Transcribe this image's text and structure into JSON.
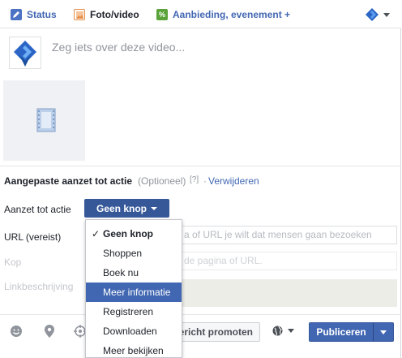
{
  "tabs": {
    "status": "Status",
    "photo_video": "Foto/video",
    "offer_event": "Aanbieding, evenement +"
  },
  "composer": {
    "placeholder": "Zeg iets over deze video..."
  },
  "cta": {
    "title": "Aangepaste aanzet tot actie",
    "optional": "(Optioneel)",
    "help": "[?]",
    "dot": "·",
    "remove": "Verwijderen",
    "label": "Aanzet tot actie",
    "button_label": "Geen knop"
  },
  "fields": {
    "url_label": "URL (vereist)",
    "url_placeholder": "a of URL je wilt dat mensen gaan bezoeken",
    "heading_label": "Kop",
    "heading_placeholder": "de pagina of URL.",
    "description_label": "Linkbeschrijving"
  },
  "menu": {
    "items": [
      {
        "label": "Geen knop",
        "checked": true
      },
      {
        "label": "Shoppen"
      },
      {
        "label": "Boek nu"
      },
      {
        "label": "Meer informatie",
        "highlighted": true
      },
      {
        "label": "Registreren"
      },
      {
        "label": "Downloaden"
      },
      {
        "label": "Meer bekijken"
      }
    ],
    "check_mark": "✓"
  },
  "bottom": {
    "icons": [
      "smiley-icon",
      "location-icon",
      "target-icon"
    ],
    "promote_label": "ericht promoten",
    "publish_label": "Publiceren"
  },
  "colors": {
    "brand_blue": "#4267b2",
    "button_dark": "#365899",
    "photo_tab": "#e48c46",
    "offer_tab": "#59a33a"
  }
}
